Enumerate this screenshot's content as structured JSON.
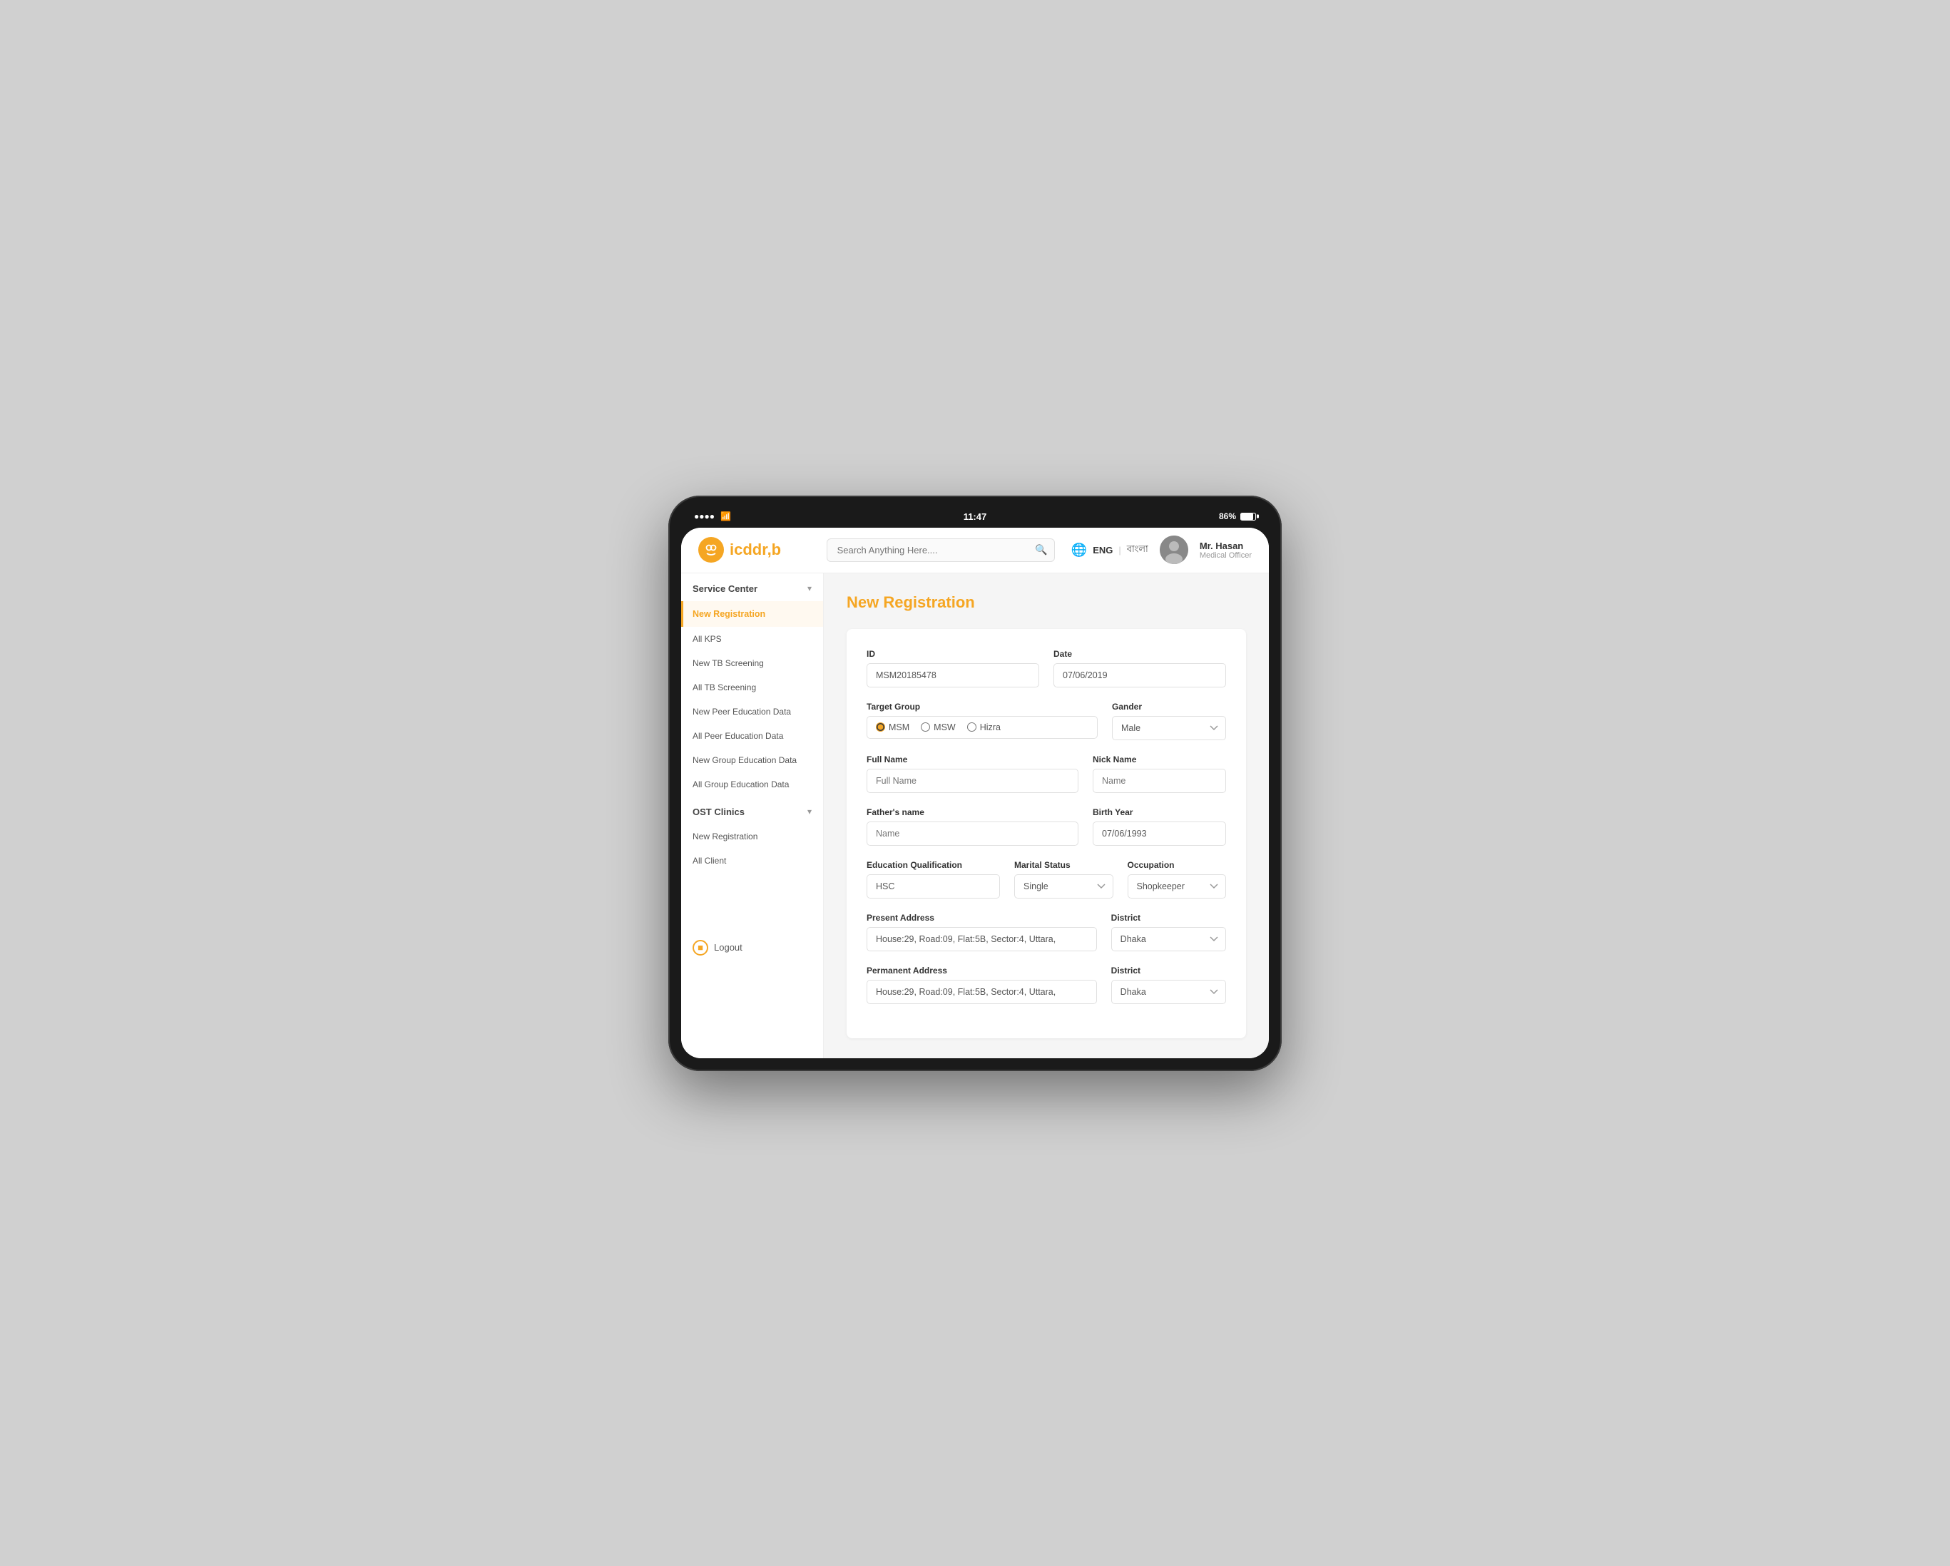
{
  "device": {
    "time": "11:47",
    "battery": "86%",
    "battery_pct": 86
  },
  "header": {
    "logo_text": "icddr,b",
    "search_placeholder": "Search Anything Here....",
    "lang_eng": "ENG",
    "lang_bn": "বাংলা",
    "user_name": "Mr. Hasan",
    "user_role": "Medical Officer"
  },
  "sidebar": {
    "service_center": "Service Center",
    "active_item": "New Registration",
    "items": [
      "All KPS",
      "New TB Screening",
      "All TB Screening",
      "New Peer Education Data",
      "All Peer Education Data",
      "New Group Education Data",
      "All Group Education Data"
    ],
    "ost_clinics": "OST Clinics",
    "ost_items": [
      "New Registration",
      "All Client"
    ],
    "logout": "Logout"
  },
  "form": {
    "title": "New Registration",
    "id_label": "ID",
    "id_value": "MSM20185478",
    "date_label": "Date",
    "date_value": "07/06/2019",
    "target_group_label": "Target Group",
    "radio_options": [
      "MSM",
      "MSW",
      "Hizra"
    ],
    "radio_selected": "MSM",
    "gender_label": "Gander",
    "gender_value": "Male",
    "fullname_label": "Full Name",
    "fullname_placeholder": "Full Name",
    "nickname_label": "Nick Name",
    "nickname_placeholder": "Name",
    "fathers_name_label": "Father's name",
    "fathers_name_placeholder": "Name",
    "birth_year_label": "Birth Year",
    "birth_year_value": "07/06/1993",
    "education_label": "Education Qualification",
    "education_value": "HSC",
    "marital_label": "Marital Status",
    "marital_value": "Single",
    "occupation_label": "Occupation",
    "occupation_value": "Shopkeeper",
    "present_address_label": "Present Address",
    "present_address_value": "House:29, Road:09, Flat:5B, Sector:4, Uttara,",
    "district1_label": "District",
    "district1_value": "Dhaka",
    "permanent_address_label": "Permanent Address",
    "permanent_address_value": "House:29, Road:09, Flat:5B, Sector:4, Uttara,",
    "district2_label": "District",
    "district2_value": "Dhaka"
  }
}
